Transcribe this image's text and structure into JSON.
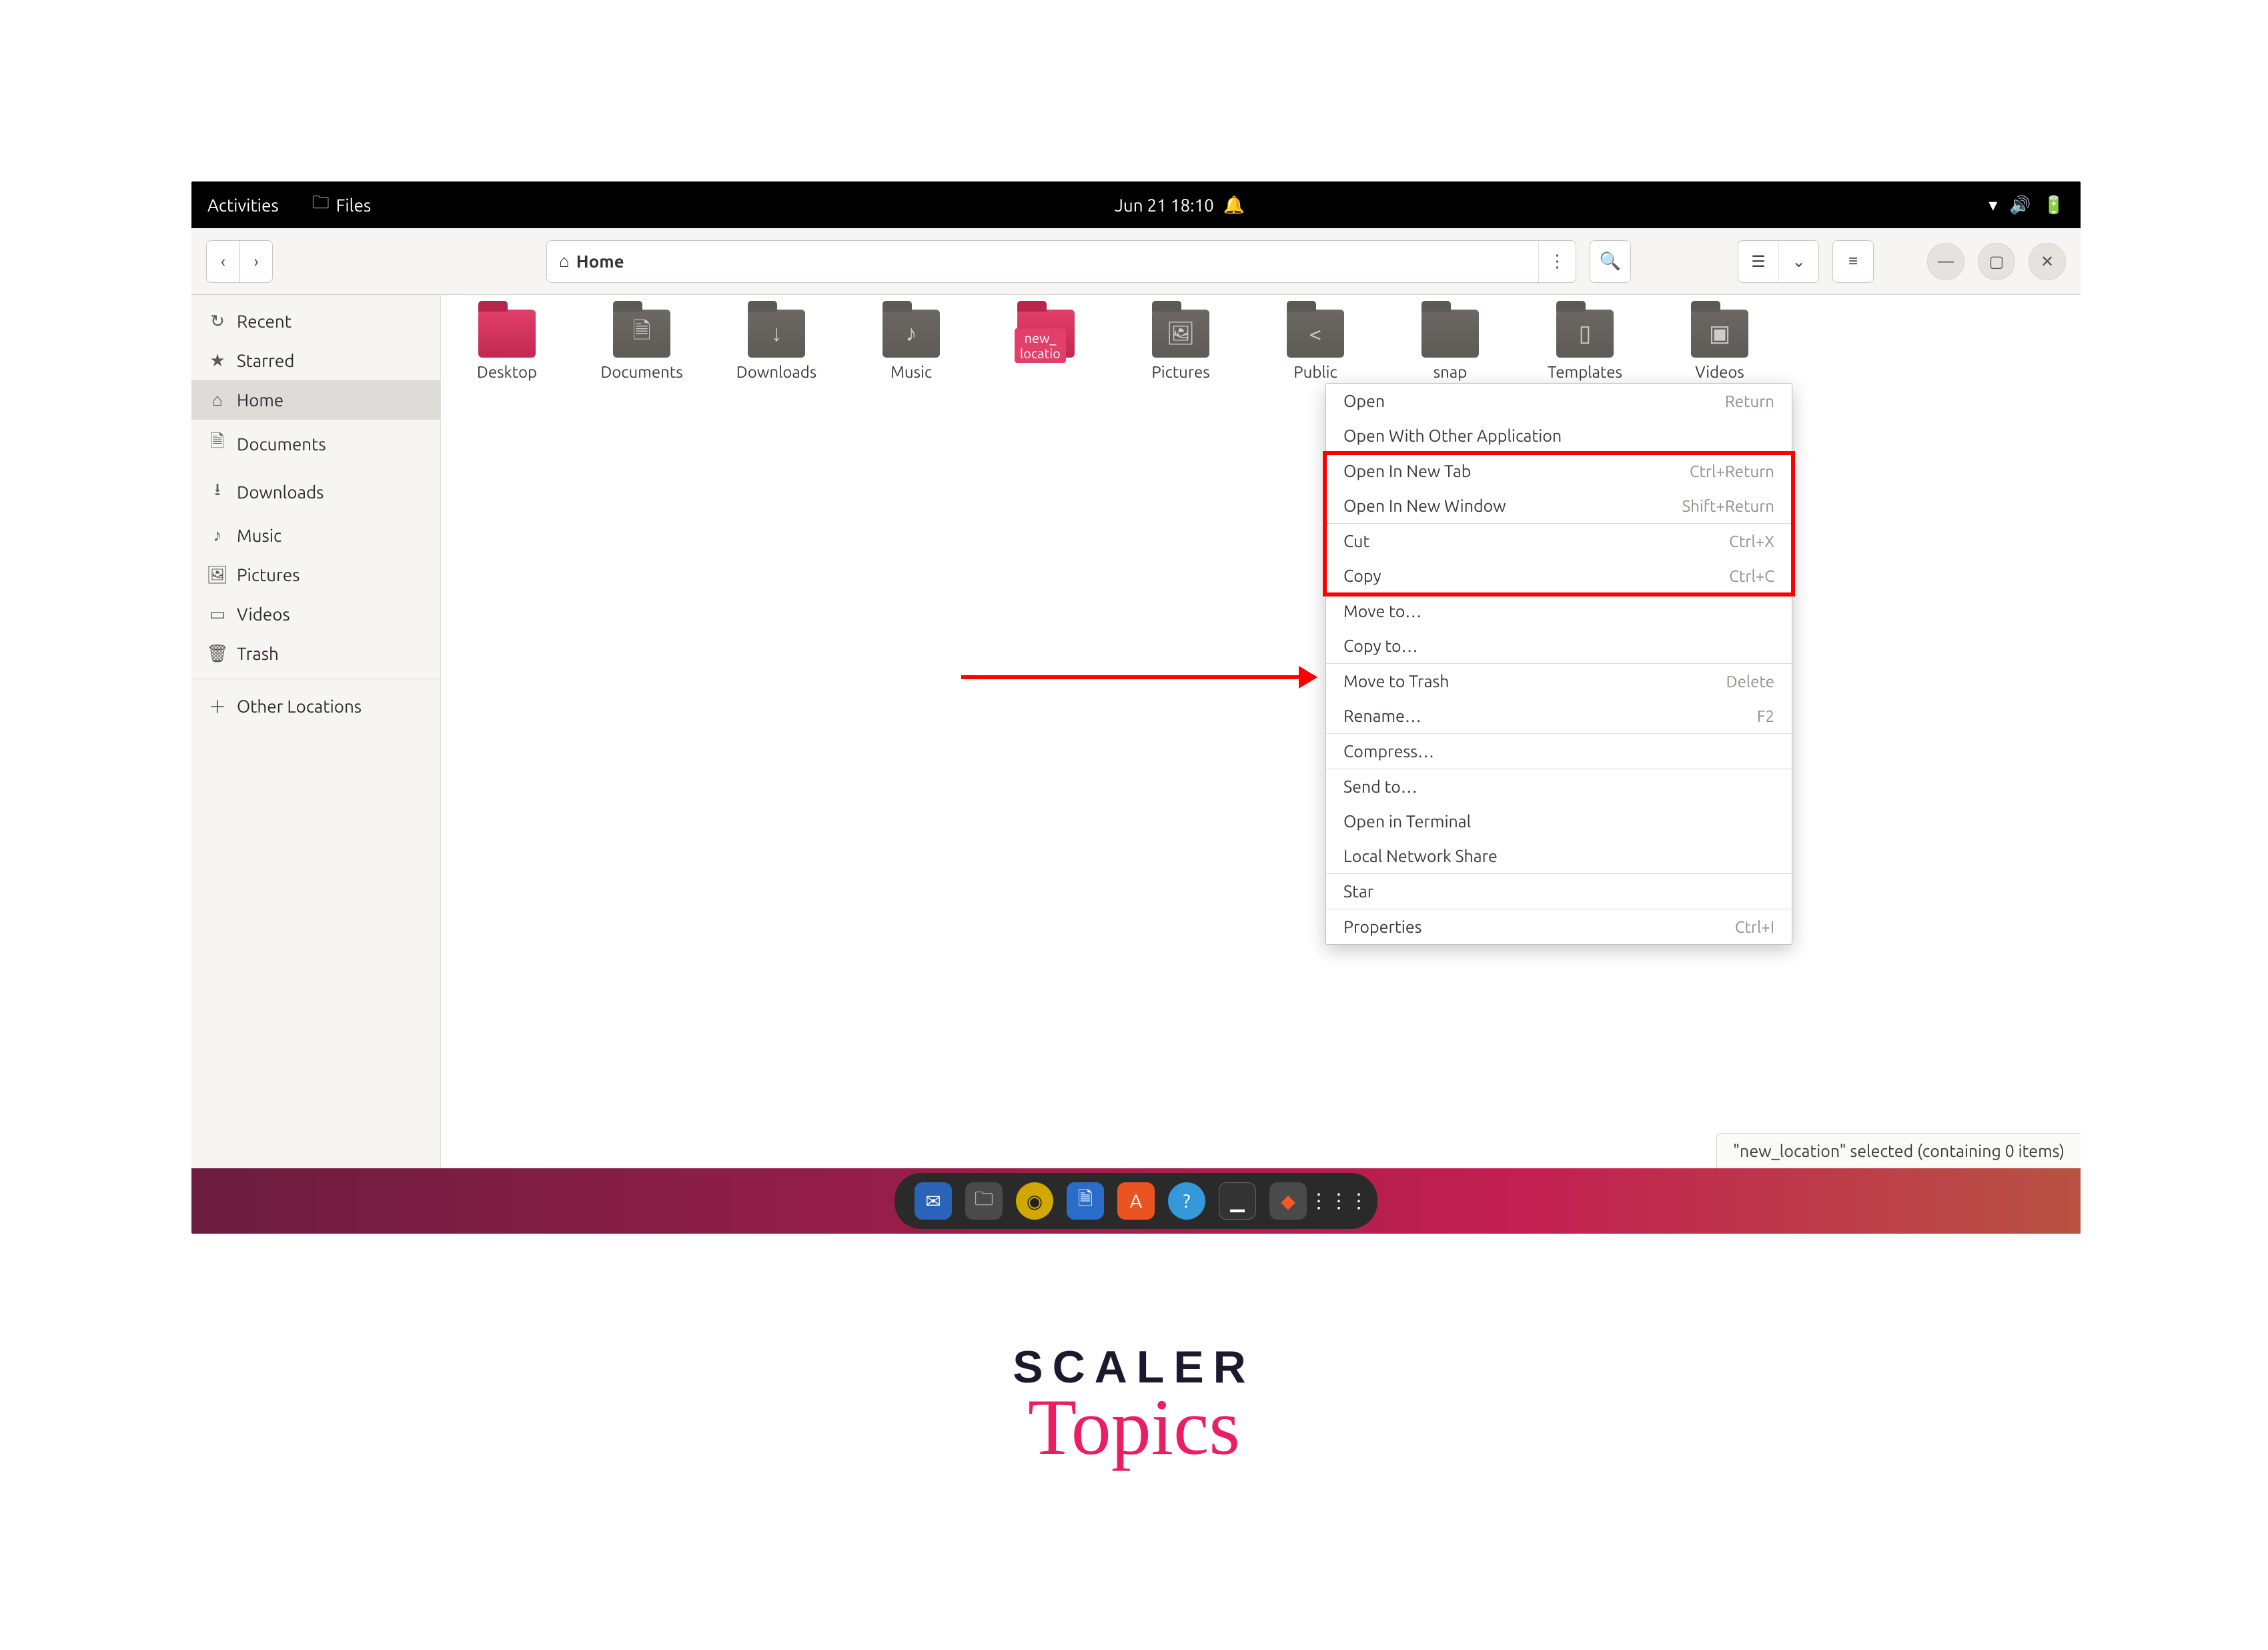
{
  "topbar": {
    "activities": "Activities",
    "app_name": "Files",
    "clock": "Jun 21  18:10"
  },
  "header": {
    "location": "Home"
  },
  "sidebar": {
    "items": [
      {
        "icon": "clock-icon",
        "label": "Recent"
      },
      {
        "icon": "star-icon",
        "label": "Starred"
      },
      {
        "icon": "home-icon",
        "label": "Home",
        "active": true
      },
      {
        "icon": "document-icon",
        "label": "Documents"
      },
      {
        "icon": "download-icon",
        "label": "Downloads"
      },
      {
        "icon": "music-icon",
        "label": "Music"
      },
      {
        "icon": "image-icon",
        "label": "Pictures"
      },
      {
        "icon": "video-icon",
        "label": "Videos"
      },
      {
        "icon": "trash-icon",
        "label": "Trash"
      }
    ],
    "other": {
      "icon": "plus-icon",
      "label": "Other Locations"
    }
  },
  "folders": [
    {
      "label": "Desktop",
      "glyph": "",
      "pink": true
    },
    {
      "label": "Documents",
      "glyph": "🗎"
    },
    {
      "label": "Downloads",
      "glyph": "↓"
    },
    {
      "label": "Music",
      "glyph": "♪"
    },
    {
      "label": "new_location",
      "glyph": "",
      "pink": true,
      "selected": true,
      "badge": "new_\nlocatio"
    },
    {
      "label": "Pictures",
      "glyph": "🖼"
    },
    {
      "label": "Public",
      "glyph": "<"
    },
    {
      "label": "snap",
      "glyph": ""
    },
    {
      "label": "Templates",
      "glyph": "▯"
    },
    {
      "label": "Videos",
      "glyph": "▣"
    }
  ],
  "ctx": {
    "groups": [
      [
        {
          "label": "Open",
          "shortcut": "Return"
        },
        {
          "label": "Open With Other Application",
          "shortcut": ""
        }
      ],
      [
        {
          "label": "Open In New Tab",
          "shortcut": "Ctrl+Return"
        },
        {
          "label": "Open In New Window",
          "shortcut": "Shift+Return"
        }
      ],
      [
        {
          "label": "Cut",
          "shortcut": "Ctrl+X"
        },
        {
          "label": "Copy",
          "shortcut": "Ctrl+C"
        }
      ],
      [
        {
          "label": "Move to…",
          "shortcut": ""
        },
        {
          "label": "Copy to…",
          "shortcut": ""
        }
      ],
      [
        {
          "label": "Move to Trash",
          "shortcut": "Delete"
        },
        {
          "label": "Rename…",
          "shortcut": "F2"
        }
      ],
      [
        {
          "label": "Compress…",
          "shortcut": ""
        }
      ],
      [
        {
          "label": "Send to…",
          "shortcut": ""
        },
        {
          "label": "Open in Terminal",
          "shortcut": ""
        },
        {
          "label": "Local Network Share",
          "shortcut": ""
        }
      ],
      [
        {
          "label": "Star",
          "shortcut": ""
        }
      ],
      [
        {
          "label": "Properties",
          "shortcut": "Ctrl+I"
        }
      ]
    ]
  },
  "statusbar": "\"new_location\" selected  (containing 0 items)",
  "watermark": {
    "line1": "SCALER",
    "line2": "Topics"
  }
}
